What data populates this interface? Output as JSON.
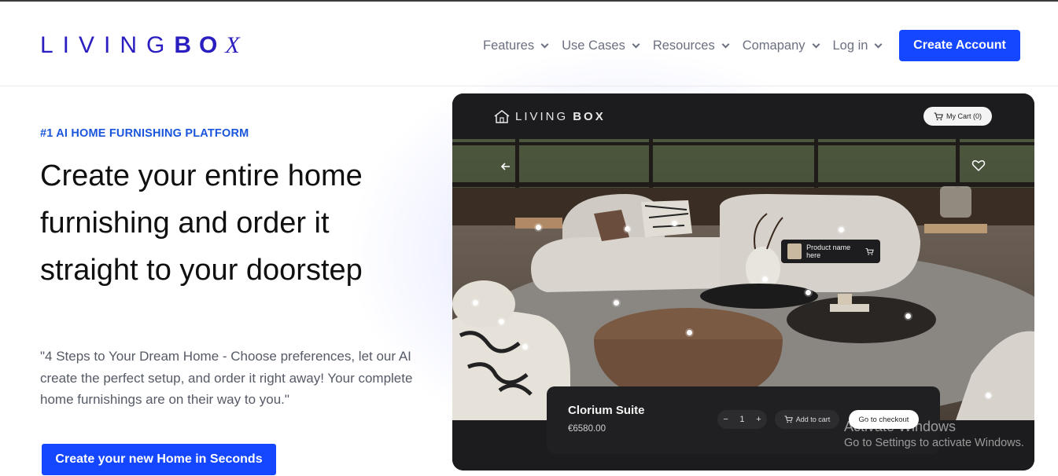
{
  "brand": {
    "logo_left": "LIVING",
    "logo_b": "BO",
    "logo_x": "X"
  },
  "nav": {
    "items": [
      {
        "label": "Features"
      },
      {
        "label": "Use Cases"
      },
      {
        "label": "Resources"
      },
      {
        "label": "Comapany"
      },
      {
        "label": "Log in"
      }
    ],
    "create_account": "Create Account"
  },
  "hero": {
    "eyebrow": "#1 AI HOME FURNISHING PLATFORM",
    "headline": "Create your entire home furnishing and order it straight to your doorstep",
    "description": "\"4 Steps to Your Dream Home - Choose preferences, let our AI create the perfect setup, and order it right away! Your complete home furnishings are on their way to you.\"",
    "cta": "Create your new Home in Seconds"
  },
  "mockup": {
    "logo_left": "LIVING",
    "logo_right": "BOX",
    "cart": "My Cart (0)",
    "tooltip": "Product name here",
    "product_name": "Clorium Suite",
    "price": "€6580.00",
    "quantity": "1",
    "minus": "−",
    "plus": "+",
    "add_to_cart": "Add to cart",
    "checkout": "Go to checkout"
  },
  "watermark": {
    "line1": "Activate Windows",
    "line2": "Go to Settings to activate Windows."
  },
  "colors": {
    "brand_blue": "#1447ff",
    "logo_blue": "#2a1ec0",
    "eyebrow_blue": "#1a56db"
  }
}
